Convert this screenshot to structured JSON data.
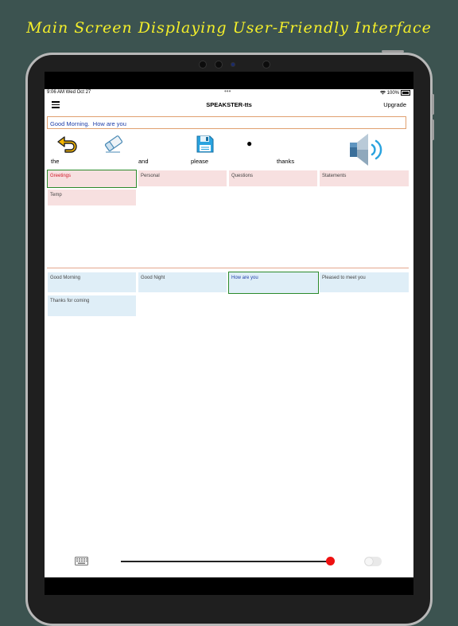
{
  "banner": {
    "text": "Main Screen Displaying User-Friendly Interface"
  },
  "status_bar": {
    "time": "9:06 AM  Wed Oct 27",
    "dots": "•••",
    "battery": "100%"
  },
  "navbar": {
    "title": "SPEAKSTER-tts",
    "upgrade_label": "Upgrade",
    "menu_icon": "hamburger-menu-icon"
  },
  "sentence": {
    "text": "Good Morning.  How are you"
  },
  "toolbar": {
    "icons": [
      "undo-arrow-icon",
      "eraser-icon",
      "save-floppy-icon",
      "speaker-icon"
    ],
    "bullet": "●"
  },
  "words": [
    "the",
    "and",
    "please",
    "thanks"
  ],
  "categories": [
    {
      "label": "Greetings",
      "selected": true
    },
    {
      "label": "Personal",
      "selected": false
    },
    {
      "label": "Questions",
      "selected": false
    },
    {
      "label": "Statements",
      "selected": false
    },
    {
      "label": "Temp",
      "selected": false
    }
  ],
  "phrases": [
    {
      "label": "Good Morning",
      "selected": false
    },
    {
      "label": "Good Night",
      "selected": false
    },
    {
      "label": "How are you",
      "selected": true
    },
    {
      "label": "Pleased to meet you",
      "selected": false
    },
    {
      "label": "Thanks for coming",
      "selected": false
    }
  ],
  "bottom": {
    "keyboard_icon": "keyboard-icon",
    "slider_value": 1.0,
    "toggle_on": false
  },
  "colors": {
    "background": "#3c5350",
    "banner": "#f4ef2a",
    "category_tile": "#f7e0e0",
    "phrase_tile": "#dfeef7",
    "selected_border": "#2b8a2b",
    "selected_category_text": "#d11a2a",
    "selected_phrase_text": "#1f3fa8",
    "sentence_text": "#1f3fa8",
    "slider_knob": "#ee1111"
  }
}
